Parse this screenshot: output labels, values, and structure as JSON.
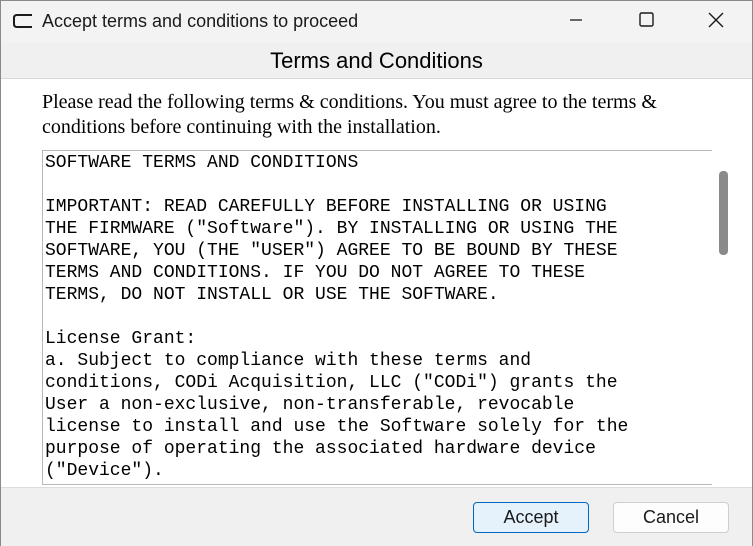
{
  "window": {
    "title": "Accept terms and conditions to proceed",
    "app_icon": "window-app-icon",
    "controls": [
      "minimize-icon",
      "maximize-icon",
      "close-icon"
    ]
  },
  "header": {
    "title": "Terms and Conditions"
  },
  "intro_text": "Please read the following terms & conditions. You must agree to the terms & conditions before continuing with the installation.",
  "terms_text": "SOFTWARE TERMS AND CONDITIONS\n\nIMPORTANT: READ CAREFULLY BEFORE INSTALLING OR USING\nTHE FIRMWARE (\"Software\"). BY INSTALLING OR USING THE\nSOFTWARE, YOU (THE \"USER\") AGREE TO BE BOUND BY THESE\nTERMS AND CONDITIONS. IF YOU DO NOT AGREE TO THESE\nTERMS, DO NOT INSTALL OR USE THE SOFTWARE.\n\nLicense Grant:\na. Subject to compliance with these terms and\nconditions, CODi Acquisition, LLC (\"CODi\") grants the\nUser a non-exclusive, non-transferable, revocable\nlicense to install and use the Software solely for the\npurpose of operating the associated hardware device\n(\"Device\").",
  "buttons": {
    "accept": "Accept",
    "cancel": "Cancel"
  },
  "colors": {
    "accent": "#0067c0",
    "accept_bg": "#e5f1fb"
  }
}
